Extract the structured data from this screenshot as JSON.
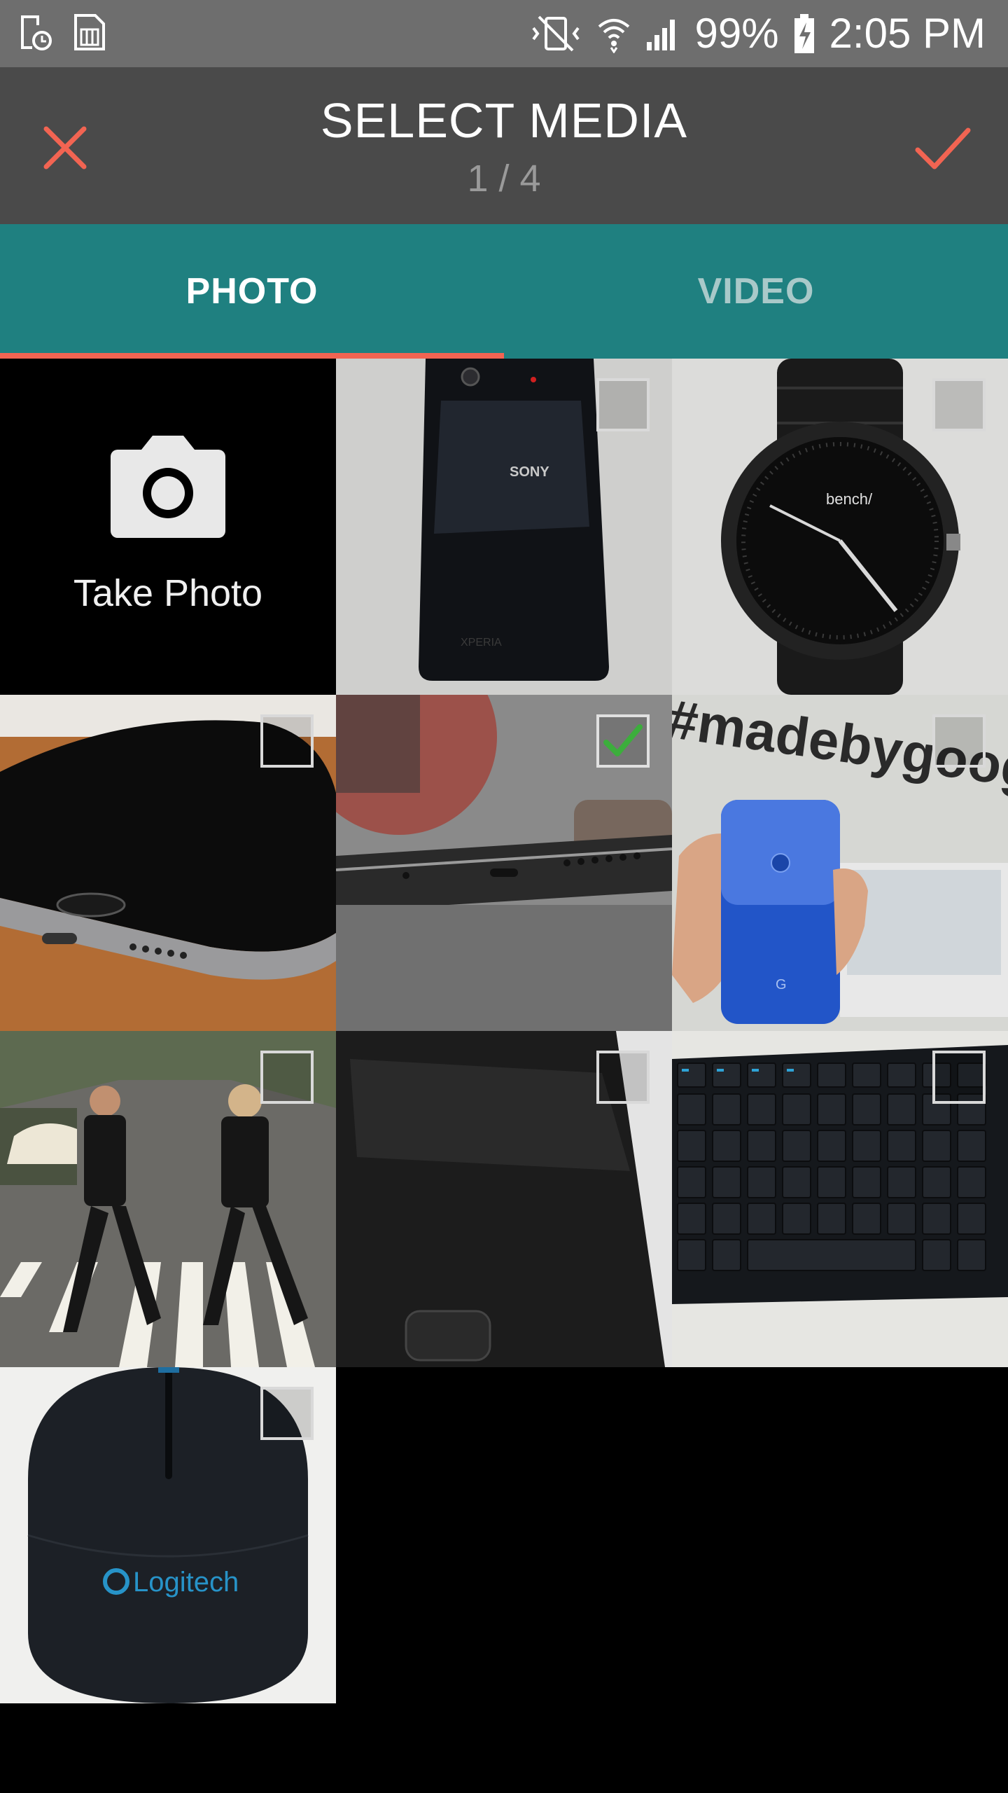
{
  "status_bar": {
    "battery": "99%",
    "time": "2:05 PM",
    "icons": [
      "sd-card-clock-icon",
      "sim-card-icon",
      "vibrate-mute-icon",
      "wifi-icon",
      "signal-icon",
      "battery-charging-icon"
    ]
  },
  "header": {
    "title": "SELECT MEDIA",
    "counter": "1 / 4",
    "close_icon": "close-icon",
    "done_icon": "check-icon",
    "accent": "#f26452"
  },
  "tabs": [
    {
      "label": "PHOTO",
      "active": true
    },
    {
      "label": "VIDEO",
      "active": false
    }
  ],
  "colors": {
    "tab_bar": "#1f8080",
    "header": "#4a4a4a",
    "indicator": "#f26452",
    "check": "#3cae3c"
  },
  "grid": {
    "take_photo_label": "Take Photo",
    "items": [
      {
        "subject": "Sony Xperia phone",
        "selected": false
      },
      {
        "subject": "bench watch",
        "selected": false
      },
      {
        "subject": "iPhone bottom edge",
        "selected": false
      },
      {
        "subject": "phone bottom port",
        "selected": true
      },
      {
        "subject": "blue Pixel phone",
        "selected": false
      },
      {
        "subject": "Abbey Road crossing",
        "selected": false
      },
      {
        "subject": "phone screen closeup",
        "selected": false
      },
      {
        "subject": "wireless keyboard",
        "selected": false
      },
      {
        "subject": "Logitech mouse",
        "selected": false
      }
    ]
  },
  "photo_text": {
    "sony": "SONY",
    "xperia": "XPERIA",
    "bench": "bench/",
    "madebygoogle": "#madebygoogle",
    "google_g": "G",
    "logitech": "Logitech"
  }
}
